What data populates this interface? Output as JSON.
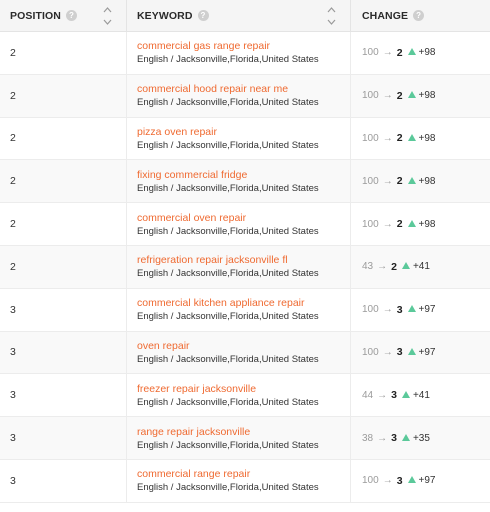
{
  "header": {
    "position_label": "POSITION",
    "keyword_label": "KEYWORD",
    "change_label": "CHANGE",
    "help_glyph": "?"
  },
  "colors": {
    "keyword_link": "#ef6a31",
    "up_arrow": "#5bc99a"
  },
  "rows": [
    {
      "position": "2",
      "keyword": "commercial gas range repair",
      "location": "English / Jacksonville,Florida,United States",
      "prev": "100",
      "arrow": "→",
      "cur": "2",
      "delta": "+98"
    },
    {
      "position": "2",
      "keyword": "commercial hood repair near me",
      "location": "English / Jacksonville,Florida,United States",
      "prev": "100",
      "arrow": "→",
      "cur": "2",
      "delta": "+98"
    },
    {
      "position": "2",
      "keyword": "pizza oven repair",
      "location": "English / Jacksonville,Florida,United States",
      "prev": "100",
      "arrow": "→",
      "cur": "2",
      "delta": "+98"
    },
    {
      "position": "2",
      "keyword": "fixing commercial fridge",
      "location": "English / Jacksonville,Florida,United States",
      "prev": "100",
      "arrow": "→",
      "cur": "2",
      "delta": "+98"
    },
    {
      "position": "2",
      "keyword": "commercial oven repair",
      "location": "English / Jacksonville,Florida,United States",
      "prev": "100",
      "arrow": "→",
      "cur": "2",
      "delta": "+98"
    },
    {
      "position": "2",
      "keyword": "refrigeration repair jacksonville fl",
      "location": "English / Jacksonville,Florida,United States",
      "prev": "43",
      "arrow": "→",
      "cur": "2",
      "delta": "+41"
    },
    {
      "position": "3",
      "keyword": "commercial kitchen appliance repair",
      "location": "English / Jacksonville,Florida,United States",
      "prev": "100",
      "arrow": "→",
      "cur": "3",
      "delta": "+97"
    },
    {
      "position": "3",
      "keyword": "oven repair",
      "location": "English / Jacksonville,Florida,United States",
      "prev": "100",
      "arrow": "→",
      "cur": "3",
      "delta": "+97"
    },
    {
      "position": "3",
      "keyword": "freezer repair jacksonville",
      "location": "English / Jacksonville,Florida,United States",
      "prev": "44",
      "arrow": "→",
      "cur": "3",
      "delta": "+41"
    },
    {
      "position": "3",
      "keyword": "range repair jacksonville",
      "location": "English / Jacksonville,Florida,United States",
      "prev": "38",
      "arrow": "→",
      "cur": "3",
      "delta": "+35"
    },
    {
      "position": "3",
      "keyword": "commercial range repair",
      "location": "English / Jacksonville,Florida,United States",
      "prev": "100",
      "arrow": "→",
      "cur": "3",
      "delta": "+97"
    }
  ]
}
